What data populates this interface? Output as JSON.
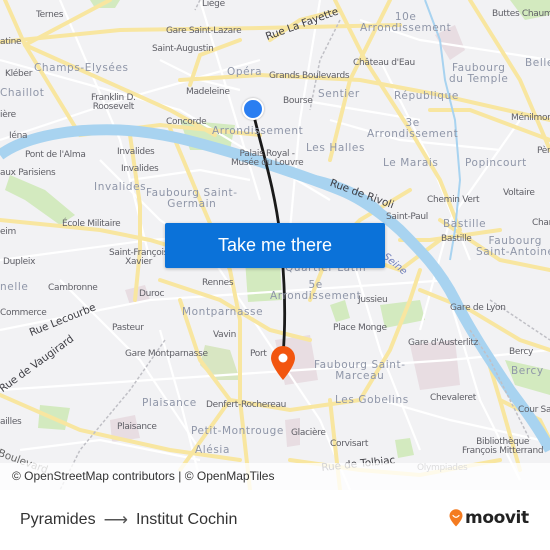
{
  "map": {
    "labels": {
      "pois": [
        {
          "id": "liege",
          "text": "Liège"
        },
        {
          "id": "ternes",
          "text": "Ternes"
        },
        {
          "id": "gare-saint-lazare",
          "text": "Gare Saint-Lazare"
        },
        {
          "id": "saint-augustin",
          "text": "Saint-Augustin"
        },
        {
          "id": "kleber",
          "text": "Kléber"
        },
        {
          "id": "franklin",
          "text": "Franklin D.\nRoosevelt"
        },
        {
          "id": "madeleine",
          "text": "Madeleine"
        },
        {
          "id": "concorde",
          "text": "Concorde"
        },
        {
          "id": "iena",
          "text": "Iéna"
        },
        {
          "id": "pont-alma",
          "text": "Pont de l'Alma"
        },
        {
          "id": "invalides-1",
          "text": "Invalides"
        },
        {
          "id": "invalides-2",
          "text": "Invalides"
        },
        {
          "id": "egouts",
          "text": "aux Parisiens"
        },
        {
          "id": "ecole-militaire",
          "text": "École Militaire"
        },
        {
          "id": "bir-hakeim",
          "text": "eim"
        },
        {
          "id": "dupleix",
          "text": "Dupleix"
        },
        {
          "id": "saint-francois",
          "text": "Saint-François\nXavier"
        },
        {
          "id": "cambronne",
          "text": "Cambronne"
        },
        {
          "id": "commerce",
          "text": "Commerce"
        },
        {
          "id": "duroc",
          "text": "Duroc"
        },
        {
          "id": "rennes",
          "text": "Rennes"
        },
        {
          "id": "pasteur",
          "text": "Pasteur"
        },
        {
          "id": "vavin",
          "text": "Vavin"
        },
        {
          "id": "gare-montparnasse",
          "text": "Gare Montparnasse"
        },
        {
          "id": "port-royal",
          "text": "Port"
        },
        {
          "id": "denfert",
          "text": "Denfert-Rochereau"
        },
        {
          "id": "plaisance-poi",
          "text": "Plaisance"
        },
        {
          "id": "vaugirard-ailles",
          "text": "ailles"
        },
        {
          "id": "chateau-eau",
          "text": "Château d'Eau"
        },
        {
          "id": "grands-boulevards",
          "text": "Grands Boulevards"
        },
        {
          "id": "bourse",
          "text": "Bourse"
        },
        {
          "id": "buttes-chaumont",
          "text": "Buttes Chaum"
        },
        {
          "id": "menilmontant",
          "text": "Ménilmon"
        },
        {
          "id": "pere-lachaise",
          "text": "Pèr"
        },
        {
          "id": "palais-royal",
          "text": "Palais Royal -\nMusée du Louvre"
        },
        {
          "id": "chemin-vert",
          "text": "Chemin Vert"
        },
        {
          "id": "voltaire",
          "text": "Voltaire"
        },
        {
          "id": "charonne",
          "text": "Char"
        },
        {
          "id": "saint-paul",
          "text": "Saint-Paul"
        },
        {
          "id": "bastille-poi",
          "text": "Bastille"
        },
        {
          "id": "jussieu",
          "text": "Jussieu"
        },
        {
          "id": "place-monge",
          "text": "Place Monge"
        },
        {
          "id": "gare-de-lyon",
          "text": "Gare de Lyon"
        },
        {
          "id": "gare-austerlitz",
          "text": "Gare d'Austerlitz"
        },
        {
          "id": "bercy-poi",
          "text": "Bercy"
        },
        {
          "id": "chevaleret",
          "text": "Chevaleret"
        },
        {
          "id": "cour-saint-emilion",
          "text": "Cour Sa"
        },
        {
          "id": "glaciere",
          "text": "Glacière"
        },
        {
          "id": "corvisart",
          "text": "Corvisart"
        },
        {
          "id": "bibliotheque",
          "text": "Bibliothèque\nFrançois Mitterrand"
        },
        {
          "id": "olympiades",
          "text": "Olympiades"
        },
        {
          "id": "la-muette-edge",
          "text": "atine"
        },
        {
          "id": "trocadero-edge",
          "text": "ière"
        }
      ],
      "areas": [
        {
          "id": "champs-elysees",
          "text": "Champs-Elysées"
        },
        {
          "id": "chaillot",
          "text": "Chaillot"
        },
        {
          "id": "opera",
          "text": "Opéra"
        },
        {
          "id": "arrondissement-1",
          "text": "Arrondissement"
        },
        {
          "id": "arr-10",
          "text": "10e\nArrondissement"
        },
        {
          "id": "sentier",
          "text": "Sentier"
        },
        {
          "id": "republique",
          "text": "République"
        },
        {
          "id": "faubourg-temple",
          "text": "Faubourg\ndu Temple"
        },
        {
          "id": "belleville",
          "text": "Belle"
        },
        {
          "id": "arr-3",
          "text": "3e\nArrondissement"
        },
        {
          "id": "les-halles",
          "text": "Les Halles"
        },
        {
          "id": "le-marais",
          "text": "Le Marais"
        },
        {
          "id": "popincourt",
          "text": "Popincourt"
        },
        {
          "id": "invalides-area",
          "text": "Invalides"
        },
        {
          "id": "faubourg-st-germain",
          "text": "Faubourg Saint-\nGermain"
        },
        {
          "id": "bastille-area",
          "text": "Bastille"
        },
        {
          "id": "faubourg-st-antoine",
          "text": "Faubourg\nSaint-Antoine"
        },
        {
          "id": "quartier-latin",
          "text": "Quartier Latin"
        },
        {
          "id": "arr-5",
          "text": "5e\nArrondissement"
        },
        {
          "id": "grenelle",
          "text": "nelle"
        },
        {
          "id": "montparnasse",
          "text": "Montparnasse"
        },
        {
          "id": "faubourg-st-marceau",
          "text": "Faubourg Saint-\nMarceau"
        },
        {
          "id": "les-gobelins",
          "text": "Les Gobelins"
        },
        {
          "id": "bercy-area",
          "text": "Bercy"
        },
        {
          "id": "plaisance-area",
          "text": "Plaisance"
        },
        {
          "id": "petit-montrouge",
          "text": "Petit-Montrouge"
        },
        {
          "id": "alesia",
          "text": "Alésia"
        }
      ],
      "streets": [
        {
          "id": "rue-la-fayette",
          "text": "Rue La Fayette"
        },
        {
          "id": "rue-de-rivoli",
          "text": "Rue de Rivoli"
        },
        {
          "id": "rue-lecourbe",
          "text": "Rue Lecourbe"
        },
        {
          "id": "rue-de-vaugirard",
          "text": "Rue de Vaugirard"
        },
        {
          "id": "boulevard",
          "text": "Boulevard"
        },
        {
          "id": "rue-de-tolbiac",
          "text": "Rue de Tolbiac"
        }
      ],
      "water": [
        {
          "id": "seine",
          "text": "Seine"
        }
      ]
    },
    "origin": {
      "name": "Pyramides",
      "color": "#2a7ef1"
    },
    "destination": {
      "name": "Institut Cochin",
      "color": "#f2550f"
    },
    "route_color": "#1a1a1a",
    "colors": {
      "background": "#f2f2f4",
      "road_major": "#f8e7a6",
      "road_minor": "#ffffff",
      "water": "#a8d3f0",
      "park": "#cfe8b6",
      "rail": "#b8b8bc"
    }
  },
  "cta": {
    "label": "Take me there",
    "color": "#0b72d9"
  },
  "attribution": {
    "text": "© OpenStreetMap contributors | © OpenMapTiles"
  },
  "footer": {
    "origin": "Pyramides",
    "arrow": "⟶",
    "destination": "Institut Cochin",
    "brand": "moovit",
    "brand_color": "#f47b20"
  }
}
